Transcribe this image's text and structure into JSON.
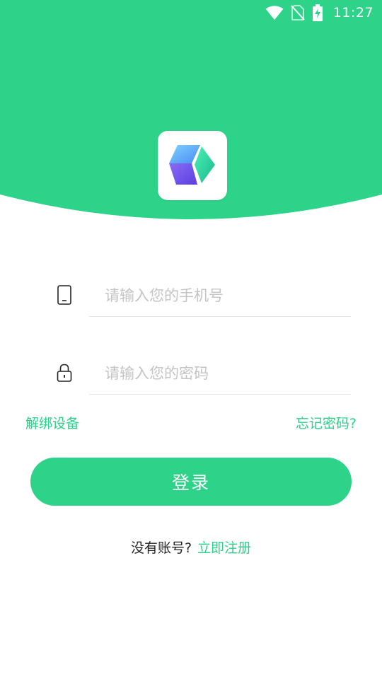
{
  "status_bar": {
    "time": "11:27",
    "icons": [
      "wifi-icon",
      "no-sim-icon",
      "battery-charging-icon"
    ]
  },
  "colors": {
    "brand_green": "#2ED38A",
    "link_green": "#2ECF88",
    "placeholder": "#C4C4C4"
  },
  "logo": {
    "icon": "cube-logo-icon"
  },
  "form": {
    "phone": {
      "icon": "phone-icon",
      "placeholder": "请输入您的手机号",
      "value": ""
    },
    "password": {
      "icon": "lock-icon",
      "placeholder": "请输入您的密码",
      "value": ""
    },
    "unbind_label": "解绑设备",
    "forgot_label": "忘记密码?",
    "login_label": "登录"
  },
  "register": {
    "prompt": "没有账号?",
    "link_label": "立即注册"
  }
}
